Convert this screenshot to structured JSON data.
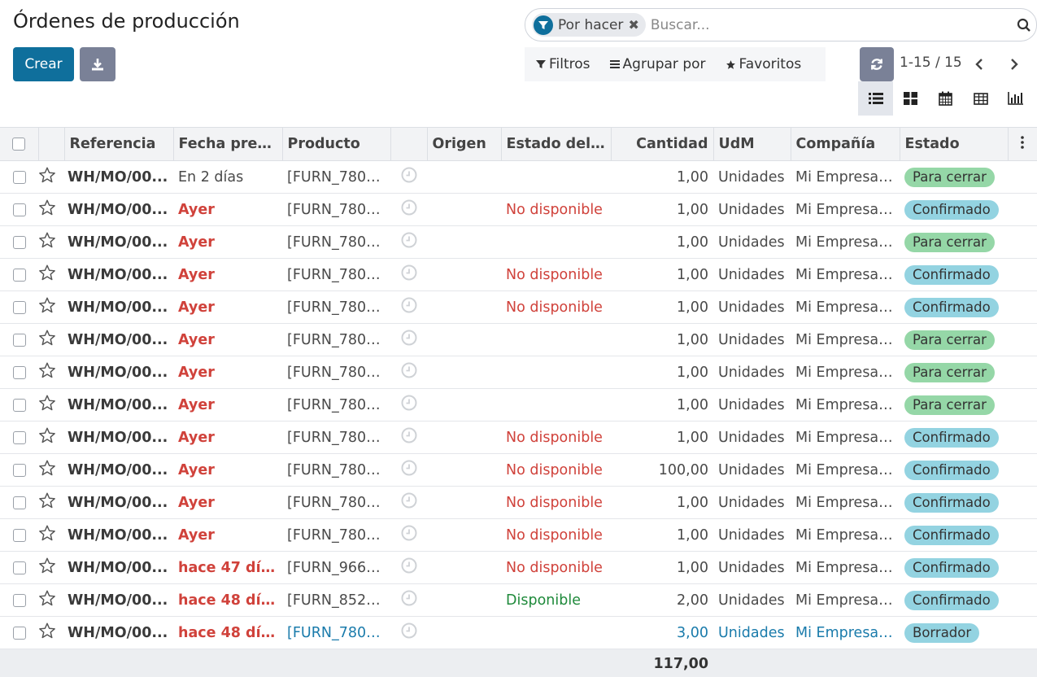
{
  "header": {
    "title": "Órdenes de producción",
    "create_label": "Crear",
    "download_icon": "download-icon"
  },
  "search": {
    "facet_label": "Por hacer",
    "facet_close": "✖",
    "placeholder": "Buscar..."
  },
  "toolbar": {
    "filters": "Filtros",
    "group_by": "Agrupar por",
    "favorites": "Favoritos"
  },
  "pager": {
    "value": "1-15 / 15"
  },
  "table": {
    "columns": [
      "Referencia",
      "Fecha previ...",
      "Producto",
      "Origen",
      "Estado del c...",
      "Cantidad",
      "UdM",
      "Compañía",
      "Estado"
    ],
    "rows": [
      {
        "ref": "WH/MO/00...",
        "date": "En 2 días",
        "date_style": "normal",
        "product": "[FURN_7800...",
        "component_state": "",
        "cs_style": "",
        "qty": "1,00",
        "uom": "Unidades",
        "company": "Mi Empresa ...",
        "state": "Para cerrar",
        "state_color": "green",
        "row_style": "normal"
      },
      {
        "ref": "WH/MO/00...",
        "date": "Ayer",
        "date_style": "red",
        "product": "[FURN_7800...",
        "component_state": "No disponible",
        "cs_style": "red",
        "qty": "1,00",
        "uom": "Unidades",
        "company": "Mi Empresa ...",
        "state": "Confirmado",
        "state_color": "cyan",
        "row_style": "normal"
      },
      {
        "ref": "WH/MO/00...",
        "date": "Ayer",
        "date_style": "red",
        "product": "[FURN_7800...",
        "component_state": "",
        "cs_style": "",
        "qty": "1,00",
        "uom": "Unidades",
        "company": "Mi Empresa ...",
        "state": "Para cerrar",
        "state_color": "green",
        "row_style": "normal"
      },
      {
        "ref": "WH/MO/00...",
        "date": "Ayer",
        "date_style": "red",
        "product": "[FURN_7800...",
        "component_state": "No disponible",
        "cs_style": "red",
        "qty": "1,00",
        "uom": "Unidades",
        "company": "Mi Empresa ...",
        "state": "Confirmado",
        "state_color": "cyan",
        "row_style": "normal"
      },
      {
        "ref": "WH/MO/00...",
        "date": "Ayer",
        "date_style": "red",
        "product": "[FURN_7800...",
        "component_state": "No disponible",
        "cs_style": "red",
        "qty": "1,00",
        "uom": "Unidades",
        "company": "Mi Empresa ...",
        "state": "Confirmado",
        "state_color": "cyan",
        "row_style": "normal"
      },
      {
        "ref": "WH/MO/00...",
        "date": "Ayer",
        "date_style": "red",
        "product": "[FURN_7800...",
        "component_state": "",
        "cs_style": "",
        "qty": "1,00",
        "uom": "Unidades",
        "company": "Mi Empresa ...",
        "state": "Para cerrar",
        "state_color": "green",
        "row_style": "normal"
      },
      {
        "ref": "WH/MO/00...",
        "date": "Ayer",
        "date_style": "red",
        "product": "[FURN_7800...",
        "component_state": "",
        "cs_style": "",
        "qty": "1,00",
        "uom": "Unidades",
        "company": "Mi Empresa ...",
        "state": "Para cerrar",
        "state_color": "green",
        "row_style": "normal"
      },
      {
        "ref": "WH/MO/00...",
        "date": "Ayer",
        "date_style": "red",
        "product": "[FURN_7800...",
        "component_state": "",
        "cs_style": "",
        "qty": "1,00",
        "uom": "Unidades",
        "company": "Mi Empresa ...",
        "state": "Para cerrar",
        "state_color": "green",
        "row_style": "normal"
      },
      {
        "ref": "WH/MO/00...",
        "date": "Ayer",
        "date_style": "red",
        "product": "[FURN_7800...",
        "component_state": "No disponible",
        "cs_style": "red",
        "qty": "1,00",
        "uom": "Unidades",
        "company": "Mi Empresa ...",
        "state": "Confirmado",
        "state_color": "cyan",
        "row_style": "normal"
      },
      {
        "ref": "WH/MO/00...",
        "date": "Ayer",
        "date_style": "red",
        "product": "[FURN_7800...",
        "component_state": "No disponible",
        "cs_style": "red",
        "qty": "100,00",
        "uom": "Unidades",
        "company": "Mi Empresa ...",
        "state": "Confirmado",
        "state_color": "cyan",
        "row_style": "normal"
      },
      {
        "ref": "WH/MO/00...",
        "date": "Ayer",
        "date_style": "red",
        "product": "[FURN_7800...",
        "component_state": "No disponible",
        "cs_style": "red",
        "qty": "1,00",
        "uom": "Unidades",
        "company": "Mi Empresa ...",
        "state": "Confirmado",
        "state_color": "cyan",
        "row_style": "normal"
      },
      {
        "ref": "WH/MO/00...",
        "date": "Ayer",
        "date_style": "red",
        "product": "[FURN_7800...",
        "component_state": "No disponible",
        "cs_style": "red",
        "qty": "1,00",
        "uom": "Unidades",
        "company": "Mi Empresa ...",
        "state": "Confirmado",
        "state_color": "cyan",
        "row_style": "normal"
      },
      {
        "ref": "WH/MO/00...",
        "date": "hace 47 días",
        "date_style": "red",
        "product": "[FURN_9666...",
        "component_state": "No disponible",
        "cs_style": "red",
        "qty": "1,00",
        "uom": "Unidades",
        "company": "Mi Empresa ...",
        "state": "Confirmado",
        "state_color": "cyan",
        "row_style": "normal"
      },
      {
        "ref": "WH/MO/00...",
        "date": "hace 48 días",
        "date_style": "red",
        "product": "[FURN_8522...",
        "component_state": "Disponible",
        "cs_style": "green",
        "qty": "2,00",
        "uom": "Unidades",
        "company": "Mi Empresa ...",
        "state": "Confirmado",
        "state_color": "cyan",
        "row_style": "normal"
      },
      {
        "ref": "WH/MO/00...",
        "date": "hace 48 días",
        "date_style": "red",
        "product": "[FURN_7800...",
        "component_state": "",
        "cs_style": "",
        "qty": "3,00",
        "uom": "Unidades",
        "company": "Mi Empresa ...",
        "state": "Borrador",
        "state_color": "cyan",
        "row_style": "blue"
      }
    ],
    "total_qty": "117,00"
  },
  "colors": {
    "primary": "#0f6f9c",
    "secondary": "#7a8197",
    "badge_green": "#95d7a7",
    "badge_cyan": "#93d3e1",
    "danger": "#d0423b",
    "success": "#1f8a3b",
    "draft_link": "#1a7bab"
  }
}
